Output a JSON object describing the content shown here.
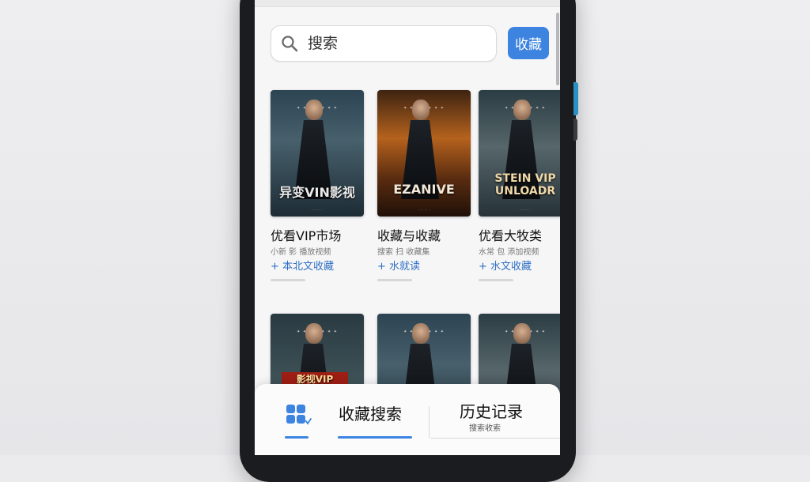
{
  "search": {
    "placeholder": "搜索",
    "button_label": "收藏"
  },
  "movies": [
    {
      "poster_title": "异变VIN影视",
      "title": "优看VIP市场",
      "meta": "小新 影 播放视频",
      "add_label": "+ 本北文收藏"
    },
    {
      "poster_title": "EZANIVE",
      "title": "收藏与收藏",
      "meta": "搜索 扫 收藏集",
      "add_label": "+ 水就读"
    },
    {
      "poster_title": "STEIN VIP UNLOADR",
      "title": "优看大牧类",
      "meta": "水常 包 添加视频",
      "add_label": "+ 水文收藏"
    },
    {
      "poster_title": "影视VIP"
    },
    {
      "poster_title": ""
    },
    {
      "poster_title": ""
    }
  ],
  "bottom_nav": {
    "favorites_tab": "收藏搜索",
    "history_tab": "历史记录",
    "history_sub": "搜索收索"
  },
  "colors": {
    "accent": "#3d84e0",
    "link": "#2f6fc3"
  }
}
